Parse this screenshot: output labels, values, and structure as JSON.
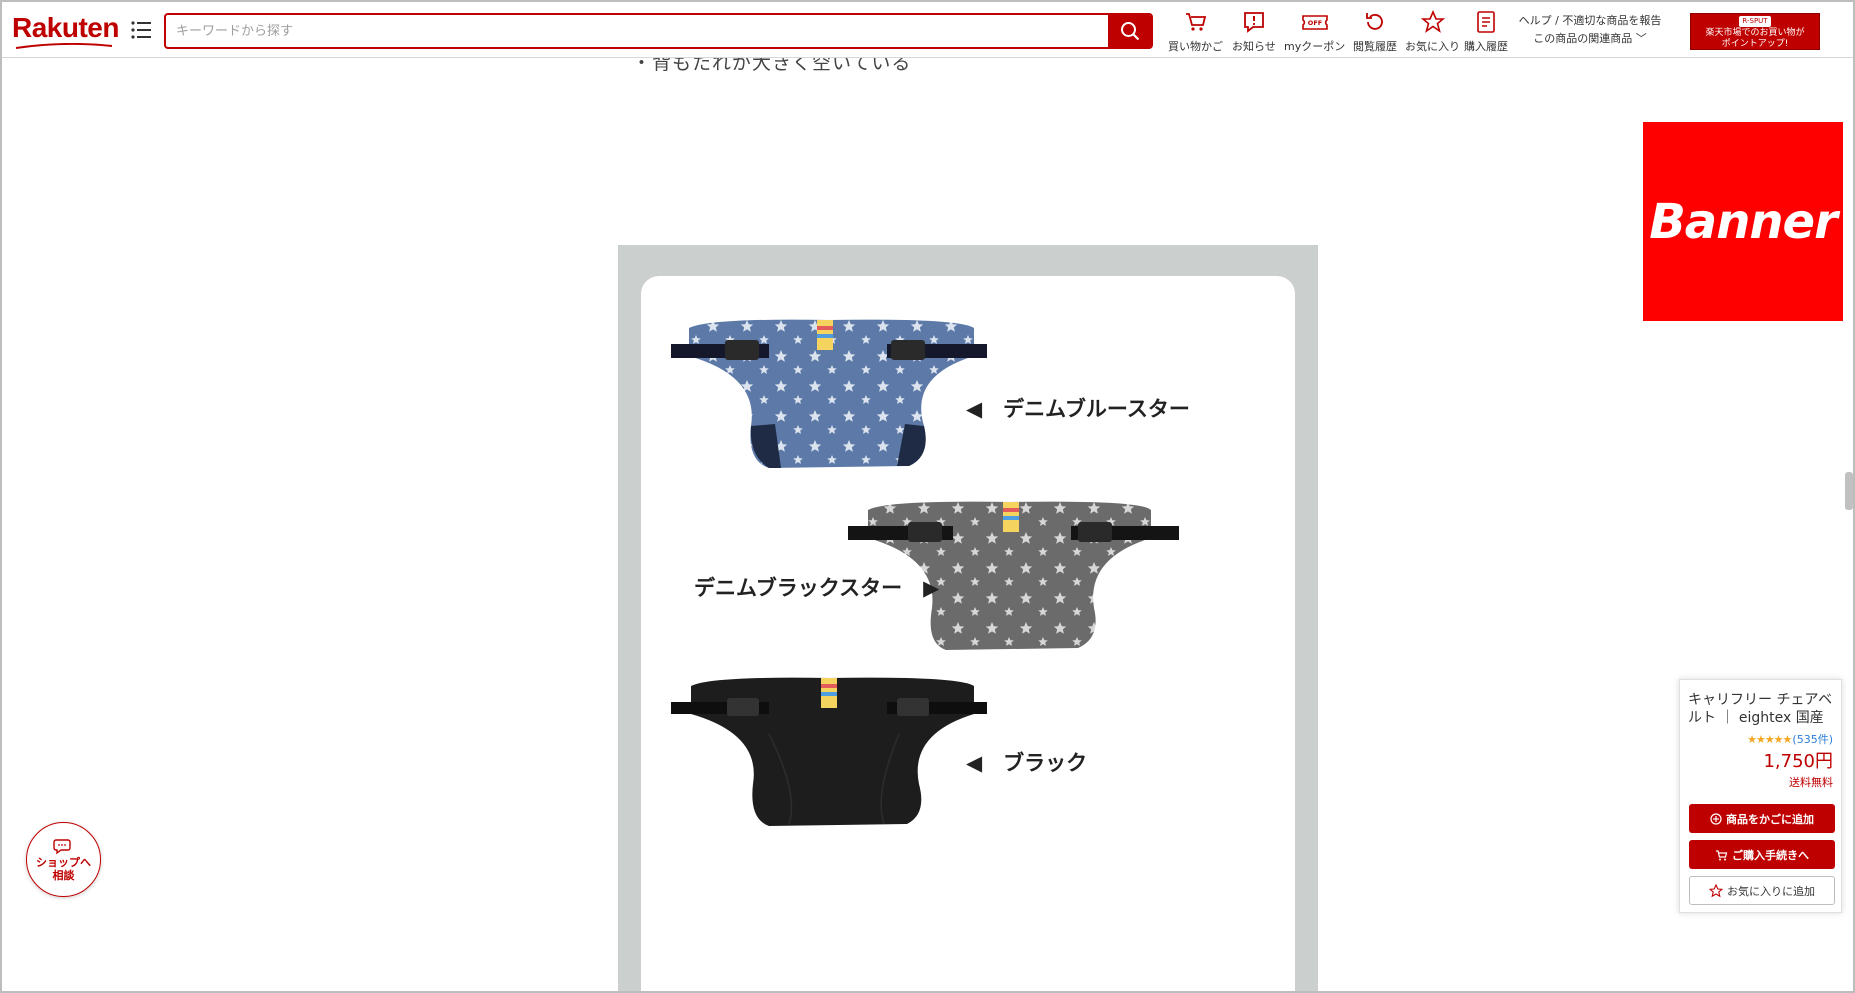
{
  "header": {
    "logo": "Rakuten",
    "search": {
      "placeholder": "キーワードから探す",
      "value": ""
    },
    "nav": [
      {
        "label": "買い物かご",
        "icon": "cart-icon"
      },
      {
        "label": "お知らせ",
        "icon": "notification-icon"
      },
      {
        "label": "myクーポン",
        "icon": "coupon-icon"
      },
      {
        "label": "閲覧履歴",
        "icon": "history-icon"
      },
      {
        "label": "お気に入り",
        "icon": "star-icon"
      },
      {
        "label": "購入履歴",
        "icon": "receipt-icon"
      }
    ],
    "help_line1": "ヘルプ / 不適切な商品を報告",
    "help_line2": "この商品の関連商品 ﹀",
    "spu_tag": "R-SPUT",
    "spu_line1": "楽天市場でのお買い物が",
    "spu_line2": "ポイントアップ!"
  },
  "main": {
    "cut_text": "・背もたれが大きく空いている",
    "variants": [
      {
        "label": "◀　デニムブルースター",
        "color": "#5c79a8"
      },
      {
        "label": "デニムブラックスター　▶",
        "color": "#6d6d6d"
      },
      {
        "label": "◀　ブラック",
        "color": "#1d1d1d"
      }
    ]
  },
  "banner": {
    "text": "Banner",
    "color": "#ff0000"
  },
  "chat": {
    "line1": "ショップへ",
    "line2": "相談"
  },
  "widget": {
    "title": "キャリフリー チェアベルト ｜ eightex 国産 ...",
    "stars": "★★★★★",
    "reviews": "(535件)",
    "price": "1,750円",
    "shipping": "送料無料",
    "add_cart": "商品をかごに追加",
    "checkout": "ご購入手続きへ",
    "favorite": "お気に入りに追加"
  },
  "colors": {
    "brand": "#bf0000"
  }
}
